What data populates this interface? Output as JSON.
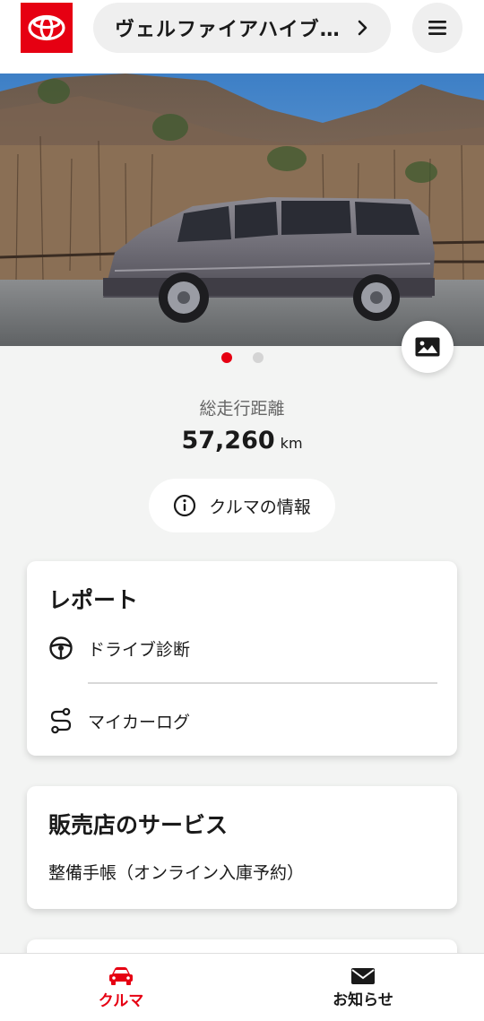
{
  "header": {
    "brand_logo": "toyota-logo",
    "vehicle_title": "ヴェルファイアハイブ...",
    "brand_color": "#e60012"
  },
  "hero": {
    "image_description_icon": "car-photo",
    "carousel_count": 2,
    "active_index": 0
  },
  "mileage": {
    "label": "総走行距離",
    "value": "57,260",
    "unit": "km"
  },
  "info_button": {
    "label": "クルマの情報",
    "icon": "info-icon"
  },
  "report_card": {
    "title": "レポート",
    "items": [
      {
        "label": "ドライブ診断",
        "icon": "steering-wheel-icon"
      },
      {
        "label": "マイカーログ",
        "icon": "route-icon"
      }
    ]
  },
  "service_card": {
    "title": "販売店のサービス",
    "items": [
      {
        "label": "整備手帳（オンライン入庫予約）"
      }
    ]
  },
  "bottom_nav": {
    "items": [
      {
        "label": "クルマ",
        "icon": "car-icon",
        "active": true
      },
      {
        "label": "お知らせ",
        "icon": "mail-icon",
        "active": false
      }
    ]
  }
}
